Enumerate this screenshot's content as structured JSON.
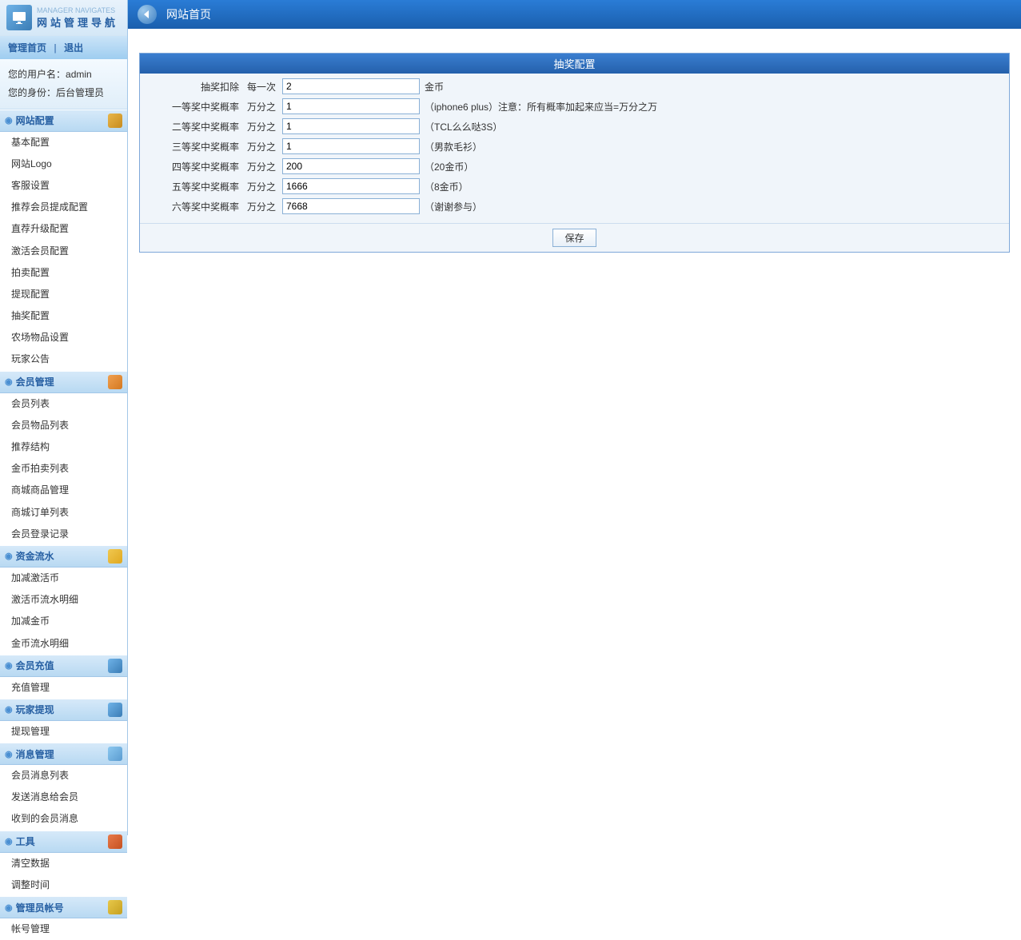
{
  "sidebar": {
    "header_sub": "MANAGER NAVIGATES",
    "header_title": "网站管理导航",
    "link_home": "管理首页",
    "link_logout": "退出",
    "user_label": "您的用户名：",
    "user_value": "admin",
    "role_label": "您的身份：",
    "role_value": "后台管理员"
  },
  "nav": {
    "sections": [
      {
        "title": "网站配置",
        "icon": "wrench",
        "items": [
          "基本配置",
          "网站Logo",
          "客服设置",
          "推荐会员提成配置",
          "直荐升级配置",
          "激活会员配置",
          "拍卖配置",
          "提现配置",
          "抽奖配置",
          "农场物品设置",
          "玩家公告"
        ]
      },
      {
        "title": "会员管理",
        "icon": "people",
        "items": [
          "会员列表",
          "会员物品列表",
          "推荐结构",
          "金币拍卖列表",
          "商城商品管理",
          "商城订单列表",
          "会员登录记录"
        ]
      },
      {
        "title": "资金流水",
        "icon": "lock",
        "items": [
          "加减激活币",
          "激活币流水明细",
          "加减金币",
          "金币流水明细"
        ]
      },
      {
        "title": "会员充值",
        "icon": "gear",
        "items": [
          "充值管理"
        ]
      },
      {
        "title": "玩家提现",
        "icon": "gear",
        "items": [
          "提现管理"
        ]
      },
      {
        "title": "消息管理",
        "icon": "note",
        "items": [
          "会员消息列表",
          "发送消息给会员",
          "收到的会员消息"
        ]
      },
      {
        "title": "工具",
        "icon": "house",
        "items": [
          "清空数据",
          "调整时间"
        ]
      },
      {
        "title": "管理员帐号",
        "icon": "key",
        "items": [
          "帐号管理"
        ]
      }
    ]
  },
  "main": {
    "breadcrumb": "网站首页",
    "panel_title": "抽奖配置",
    "rows": [
      {
        "label": "抽奖扣除",
        "prefix": "每一次",
        "value": "2",
        "suffix": "金币"
      },
      {
        "label": "一等奖中奖概率",
        "prefix": "万分之",
        "value": "1",
        "suffix": "（iphone6 plus）注意：所有概率加起来应当=万分之万"
      },
      {
        "label": "二等奖中奖概率",
        "prefix": "万分之",
        "value": "1",
        "suffix": "（TCL么么哒3S）"
      },
      {
        "label": "三等奖中奖概率",
        "prefix": "万分之",
        "value": "1",
        "suffix": "（男款毛衫）"
      },
      {
        "label": "四等奖中奖概率",
        "prefix": "万分之",
        "value": "200",
        "suffix": "（20金币）"
      },
      {
        "label": "五等奖中奖概率",
        "prefix": "万分之",
        "value": "1666",
        "suffix": "（8金币）"
      },
      {
        "label": "六等奖中奖概率",
        "prefix": "万分之",
        "value": "7668",
        "suffix": "（谢谢参与）"
      }
    ],
    "save": "保存"
  }
}
